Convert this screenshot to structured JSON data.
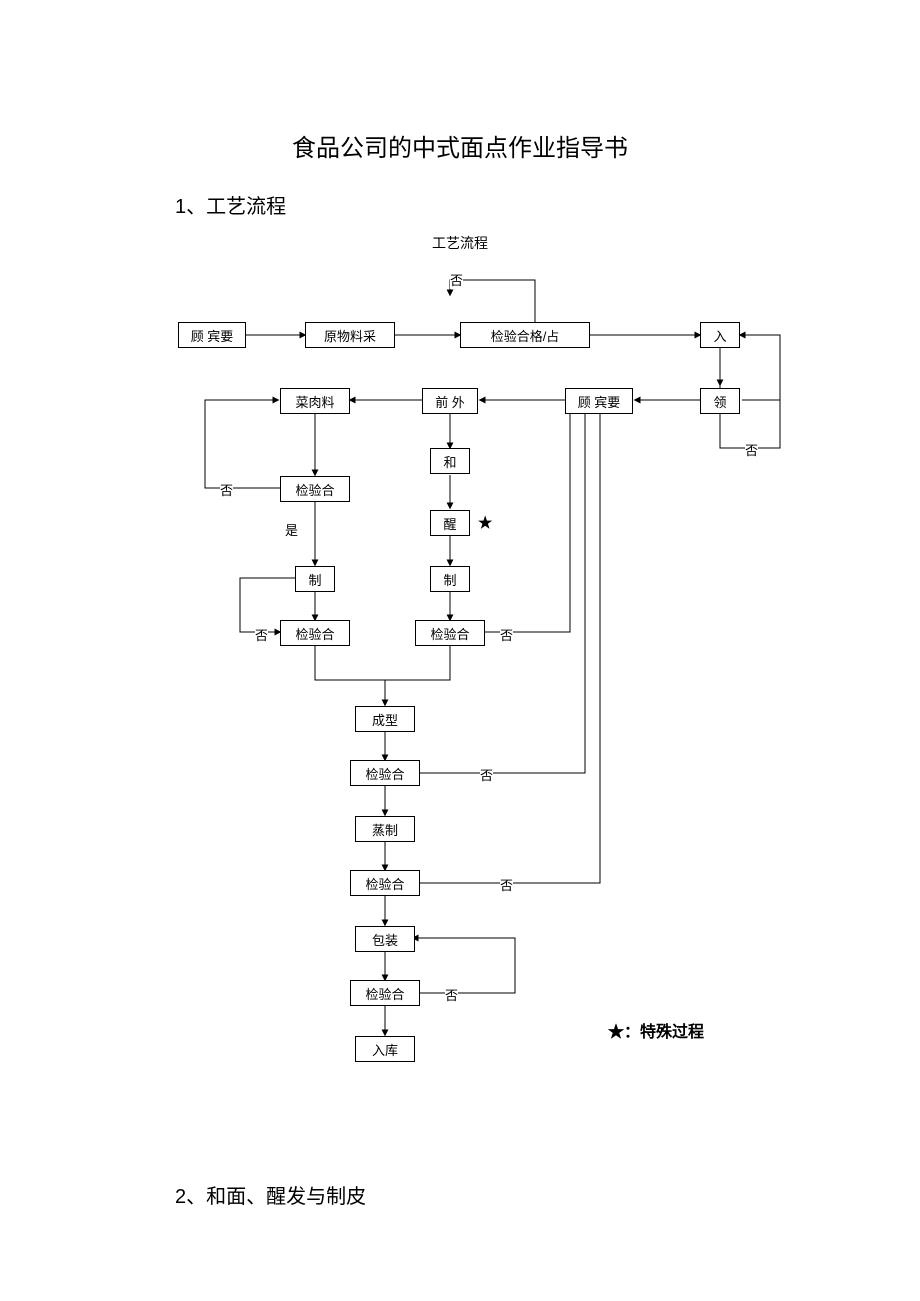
{
  "title": "食品公司的中式面点作业指导书",
  "section1": {
    "num": "1",
    "label": "、工艺流程"
  },
  "diagram": {
    "caption": "工艺流程",
    "star_legend": "★：特殊过程",
    "star": "★",
    "boxes": {
      "customer1": "顾 宾要",
      "raw": "原物料采",
      "inspect_ok": "检验合格/占",
      "in": "入",
      "receive": "领",
      "customer2": "顾 宾要",
      "prep": "前 外",
      "veg": "菜肉料",
      "mix": "和",
      "insp1": "检验合",
      "rise": "醒",
      "make1": "制",
      "make2": "制",
      "insp2": "检验合",
      "insp3": "检验合",
      "shape": "成型",
      "insp4": "检验合",
      "steam": "蒸制",
      "insp5": "检验合",
      "pack": "包装",
      "insp6": "检验合",
      "store": "入库"
    },
    "labels": {
      "fou": "否",
      "shi": "是"
    }
  },
  "section2": {
    "num": "2",
    "label": "、和面、醒发与制皮"
  }
}
